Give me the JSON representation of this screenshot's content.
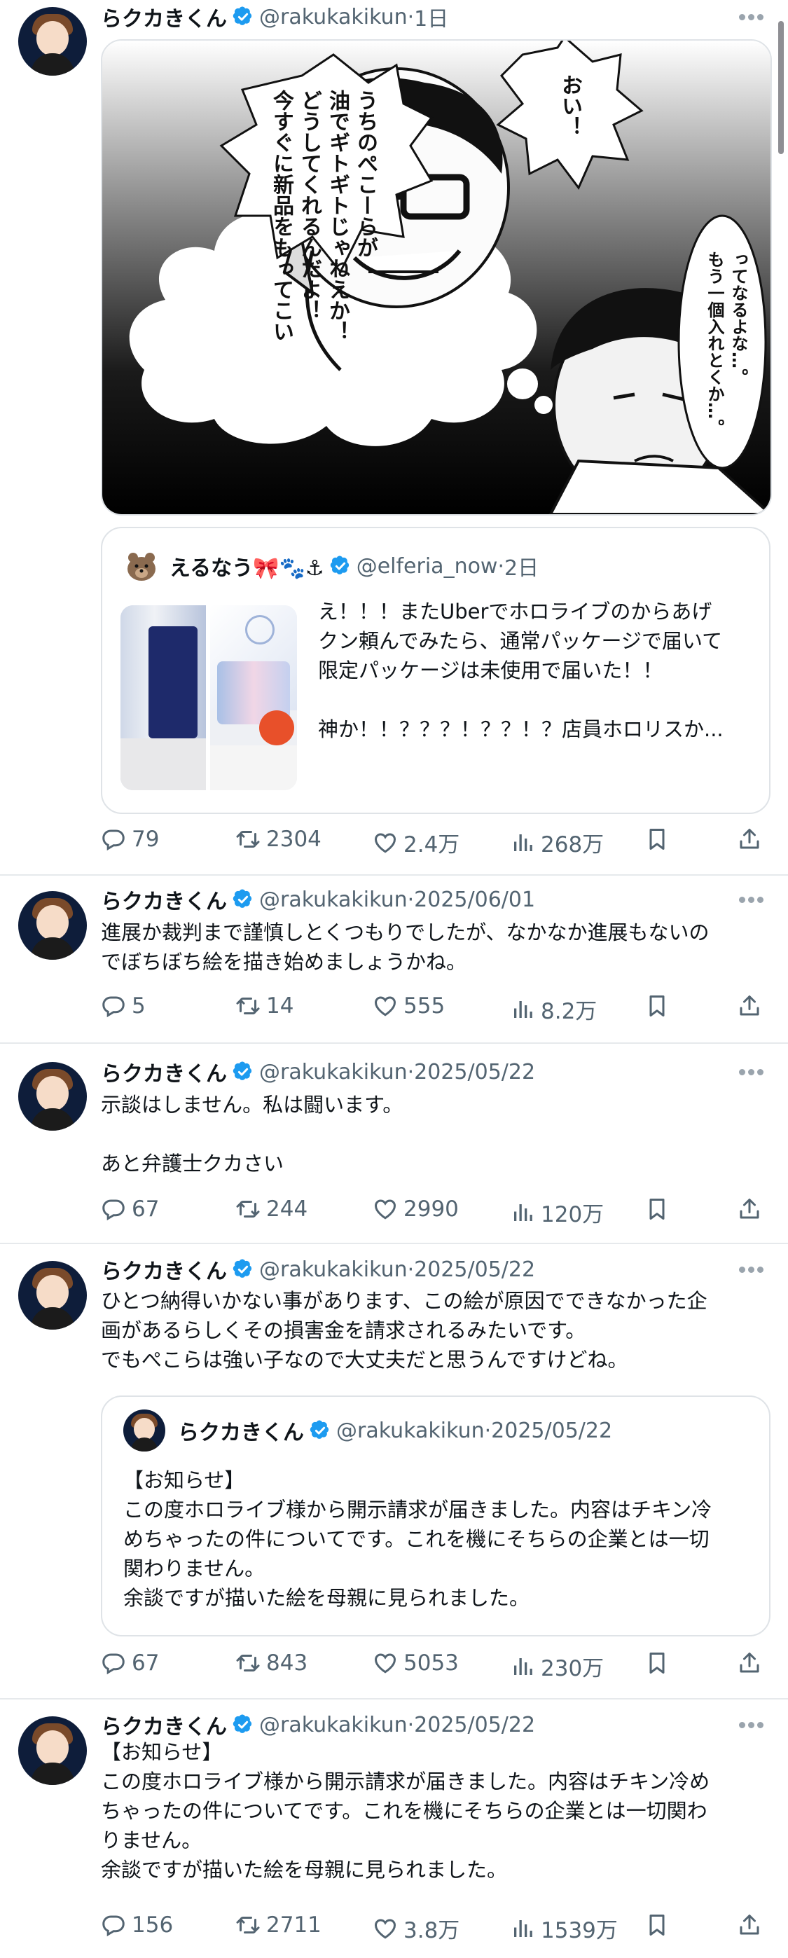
{
  "tweets": [
    {
      "name": "らクカきくん",
      "handle": "@rakukakikun",
      "date": "1日",
      "manga_texts": {
        "bubble_main": "うちのぺこーらが\n油でギトギトじゃねえか！\nどうしてくれるんだよ！\n今すぐに新品をもってこい",
        "bubble_oi": "おい！",
        "bubble_right": "ってなるよな…。\nもう一個入れとくか…。"
      },
      "quote": {
        "name": "えるなう🎀🐾⚓",
        "handle": "@elferia_now",
        "date": "2日",
        "text": "え！！！またUberでホロライブのからあげ\nクン頼んでみたら、通常パッケージで届いて\n限定パッケージは未使用で届いた！！\n\n神か！！？？？！？？！？店員ホロリスか..."
      },
      "replies": "79",
      "retweets": "2304",
      "likes": "2.4万",
      "views": "268万"
    },
    {
      "name": "らクカきくん",
      "handle": "@rakukakikun",
      "date": "2025/06/01",
      "text": "進展か裁判まで謹慎しとくつもりでしたが、なかなか進展もないの\nでぼちぼち絵を描き始めましょうかね。",
      "replies": "5",
      "retweets": "14",
      "likes": "555",
      "views": "8.2万"
    },
    {
      "name": "らクカきくん",
      "handle": "@rakukakikun",
      "date": "2025/05/22",
      "text": "示談はしません。私は闘います。\n\nあと弁護士クカさい",
      "replies": "67",
      "retweets": "244",
      "likes": "2990",
      "views": "120万"
    },
    {
      "name": "らクカきくん",
      "handle": "@rakukakikun",
      "date": "2025/05/22",
      "text": "ひとつ納得いかない事があります、この絵が原因でできなかった企\n画があるらしくその損害金を請求されるみたいです。\nでもぺこらは強い子なので大丈夫だと思うんですけどね。",
      "quote": {
        "name": "らクカきくん",
        "handle": "@rakukakikun",
        "date": "2025/05/22",
        "text": "【お知らせ】\nこの度ホロライブ様から開示請求が届きました。内容はチキン冷\nめちゃったの件についてです。これを機にそちらの企業とは一切\n関わりません。\n余談ですが描いた絵を母親に見られました。"
      },
      "replies": "67",
      "retweets": "843",
      "likes": "5053",
      "views": "230万"
    },
    {
      "name": "らクカきくん",
      "handle": "@rakukakikun",
      "date": "2025/05/22",
      "text": "【お知らせ】\nこの度ホロライブ様から開示請求が届きました。内容はチキン冷め\nちゃったの件についてです。これを機にそちらの企業とは一切関わ\nりません。\n余談ですが描いた絵を母親に見られました。",
      "replies": "156",
      "retweets": "2711",
      "likes": "3.8万",
      "views": "1539万"
    }
  ],
  "colors": {
    "verified": "#1d9bf0",
    "text": "#0f1419",
    "muted": "#536471",
    "divider": "#e6e9ec"
  }
}
